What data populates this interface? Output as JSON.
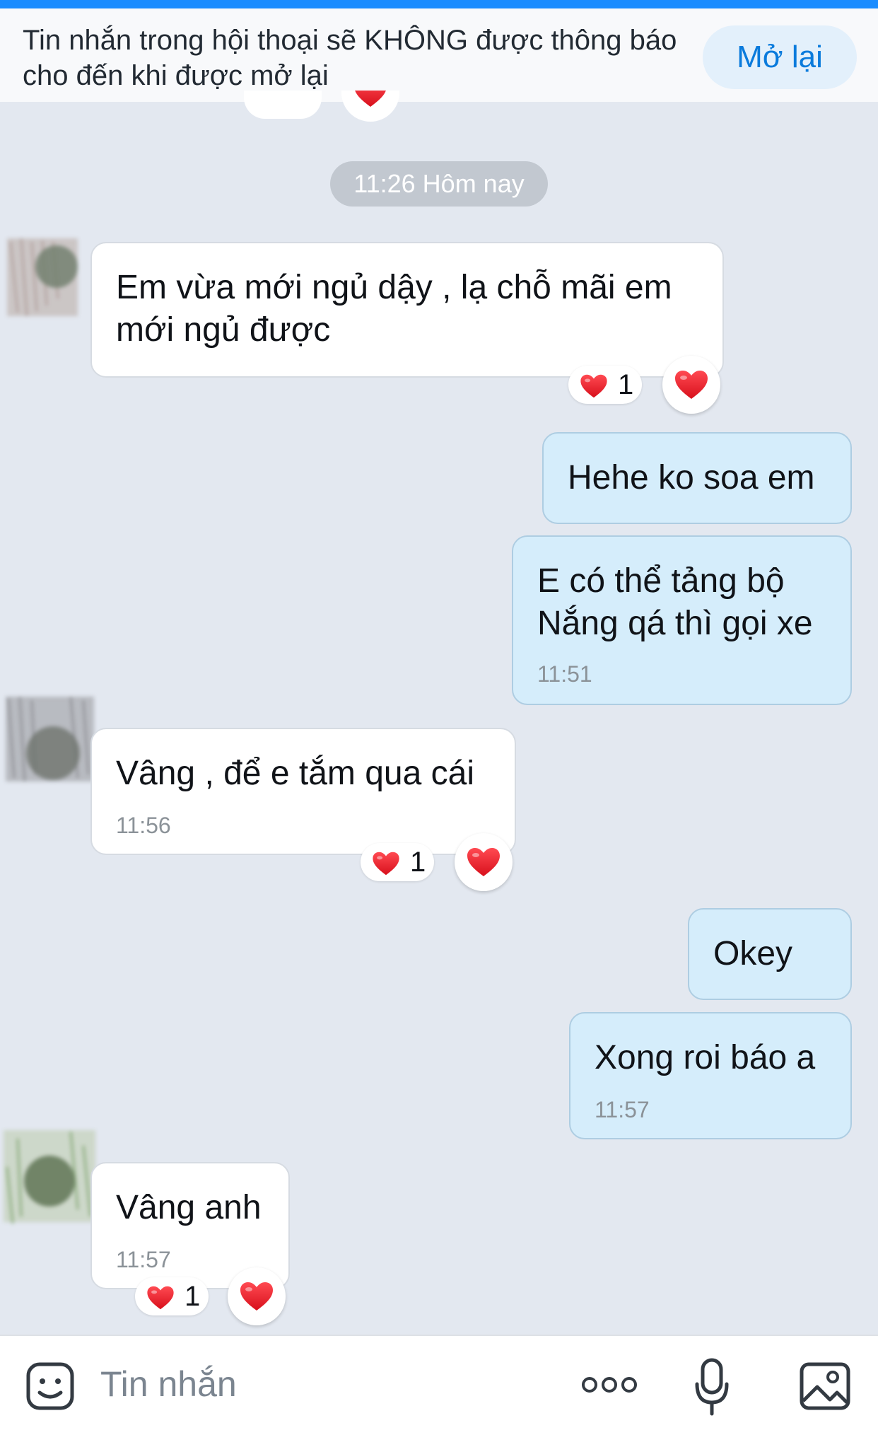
{
  "notice": {
    "text": "Tin nhắn trong hội thoại sẽ KHÔNG được thông báo cho đến khi được mở lại",
    "button_label": "Mở lại"
  },
  "time_separator": "11:26 Hôm nay",
  "messages": [
    {
      "direction": "incoming",
      "text_lines": [
        "Em vừa mới ngủ dậy , lạ chỗ mãi em",
        "mới ngủ được"
      ],
      "time": "",
      "reaction": {
        "emoji": "heart",
        "count": "1"
      }
    },
    {
      "direction": "outgoing",
      "text_lines": [
        "Hehe ko soa em"
      ],
      "time": ""
    },
    {
      "direction": "outgoing",
      "text_lines": [
        "E có thể tảng bộ",
        "Nắng qá thì gọi xe"
      ],
      "time": "11:51"
    },
    {
      "direction": "incoming",
      "text_lines": [
        "Vâng , để e tắm qua cái"
      ],
      "time": "11:56",
      "reaction": {
        "emoji": "heart",
        "count": "1"
      }
    },
    {
      "direction": "outgoing",
      "text_lines": [
        "Okey"
      ],
      "time": ""
    },
    {
      "direction": "outgoing",
      "text_lines": [
        "Xong roi báo a"
      ],
      "time": "11:57"
    },
    {
      "direction": "incoming",
      "text_lines": [
        "Vâng anh"
      ],
      "time": "11:57",
      "reaction": {
        "emoji": "heart",
        "count": "1"
      }
    }
  ],
  "input_bar": {
    "placeholder": "Tin nhắn",
    "icons": [
      "sticker-icon",
      "more-icon",
      "microphone-icon",
      "image-icon"
    ]
  },
  "colors": {
    "accent": "#1a8cff",
    "background": "#e3e8f0",
    "outgoing_bubble": "#d5edfb",
    "incoming_bubble": "#ffffff",
    "heart": "#e8121f"
  }
}
